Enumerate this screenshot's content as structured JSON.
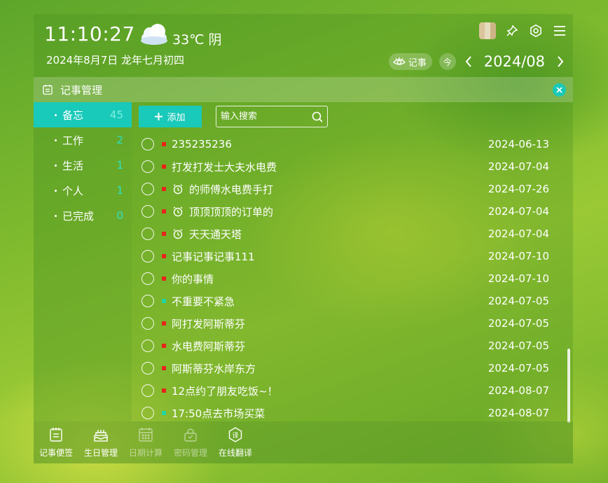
{
  "header": {
    "time": "11:10:27",
    "temperature": "33℃ 阴",
    "date": "2024年8月7日 龙年七月初四",
    "notes_pill": "记事",
    "today_label": "今",
    "month": "2024/08"
  },
  "panel": {
    "title": "记事管理"
  },
  "categories": [
    {
      "label": "备忘",
      "count": "45",
      "active": true
    },
    {
      "label": "工作",
      "count": "2"
    },
    {
      "label": "生活",
      "count": "1"
    },
    {
      "label": "个人",
      "count": "1"
    },
    {
      "label": "已完成",
      "count": "0"
    }
  ],
  "toolbar": {
    "add_label": "添加",
    "search_placeholder": "输入搜索"
  },
  "items": [
    {
      "title": "235235236",
      "date": "2024-06-13",
      "priority": "red",
      "alarm": false
    },
    {
      "title": "打发打发士大夫水电费",
      "date": "2024-07-04",
      "priority": "red",
      "alarm": false
    },
    {
      "title": "的师傅水电费手打",
      "date": "2024-07-26",
      "priority": "red",
      "alarm": true
    },
    {
      "title": "顶顶顶顶的订单的",
      "date": "2024-07-04",
      "priority": "red",
      "alarm": true
    },
    {
      "title": "天天通天塔",
      "date": "2024-07-04",
      "priority": "red",
      "alarm": true
    },
    {
      "title": "记事记事记事111",
      "date": "2024-07-10",
      "priority": "red",
      "alarm": false
    },
    {
      "title": "你的事情",
      "date": "2024-07-10",
      "priority": "red",
      "alarm": false
    },
    {
      "title": "不重要不紧急",
      "date": "2024-07-05",
      "priority": "green",
      "alarm": false
    },
    {
      "title": "阿打发阿斯蒂芬",
      "date": "2024-07-05",
      "priority": "red",
      "alarm": false
    },
    {
      "title": "水电费阿斯蒂芬",
      "date": "2024-07-05",
      "priority": "red",
      "alarm": false
    },
    {
      "title": "阿斯蒂芬水岸东方",
      "date": "2024-07-05",
      "priority": "red",
      "alarm": false
    },
    {
      "title": "12点约了朋友吃饭~！",
      "date": "2024-08-07",
      "priority": "red",
      "alarm": false
    },
    {
      "title": "17:50点去市场买菜",
      "date": "2024-08-07",
      "priority": "green",
      "alarm": false
    }
  ],
  "bottom_tools": [
    {
      "label": "记事便签",
      "icon": "notepad-icon",
      "dim": false
    },
    {
      "label": "生日管理",
      "icon": "cake-icon",
      "dim": false
    },
    {
      "label": "日期计算",
      "icon": "calculator-icon",
      "dim": true
    },
    {
      "label": "密码管理",
      "icon": "lock-icon",
      "dim": true
    },
    {
      "label": "在线翻译",
      "icon": "translate-icon",
      "dim": false
    }
  ],
  "colors": {
    "accent": "#19c9b9",
    "priority_red": "#e8241a",
    "priority_green": "#1fd6a0",
    "count_text": "#2ee0c5"
  }
}
